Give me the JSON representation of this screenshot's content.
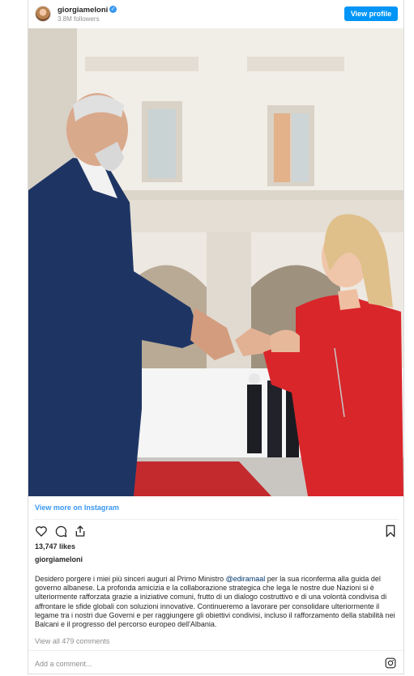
{
  "header": {
    "username": "giorgiameloni",
    "followers": "3.8M followers",
    "view_profile_label": "View profile",
    "verified_icon": "check-badge-icon"
  },
  "post": {
    "view_more_label": "View more on Instagram",
    "likes": "13,747 likes",
    "caption_user": "giorgiameloni",
    "caption_before": "Desidero porgere i miei più sinceri auguri al Primo Ministro ",
    "caption_mention": "@ediramaal",
    "caption_after": " per la sua riconferma alla guida del governo albanese. La profonda amicizia e la collaborazione strategica che lega le nostre due Nazioni si è ulteriormente rafforzata grazie a iniziative comuni, frutto di un dialogo costruttivo e di una volontà condivisa di affrontare le sfide globali con soluzioni innovative. Continueremo a lavorare per consolidare ulteriormente il legame tra i nostri due Governi e per raggiungere gli obiettivi condivisi, incluso il rafforzamento della stabilità nei Balcani e il progresso del percorso europeo dell'Albania.",
    "view_comments": "View all 479 comments",
    "comment_placeholder": "Add a comment...",
    "icons": [
      "heart-icon",
      "comment-icon",
      "share-icon",
      "bookmark-icon",
      "instagram-icon"
    ]
  },
  "colors": {
    "accent": "#0095f6",
    "link": "#3897f0",
    "muted": "#8e8e8e",
    "jacket_red": "#d9262a",
    "suit_blue": "#1e3564"
  }
}
